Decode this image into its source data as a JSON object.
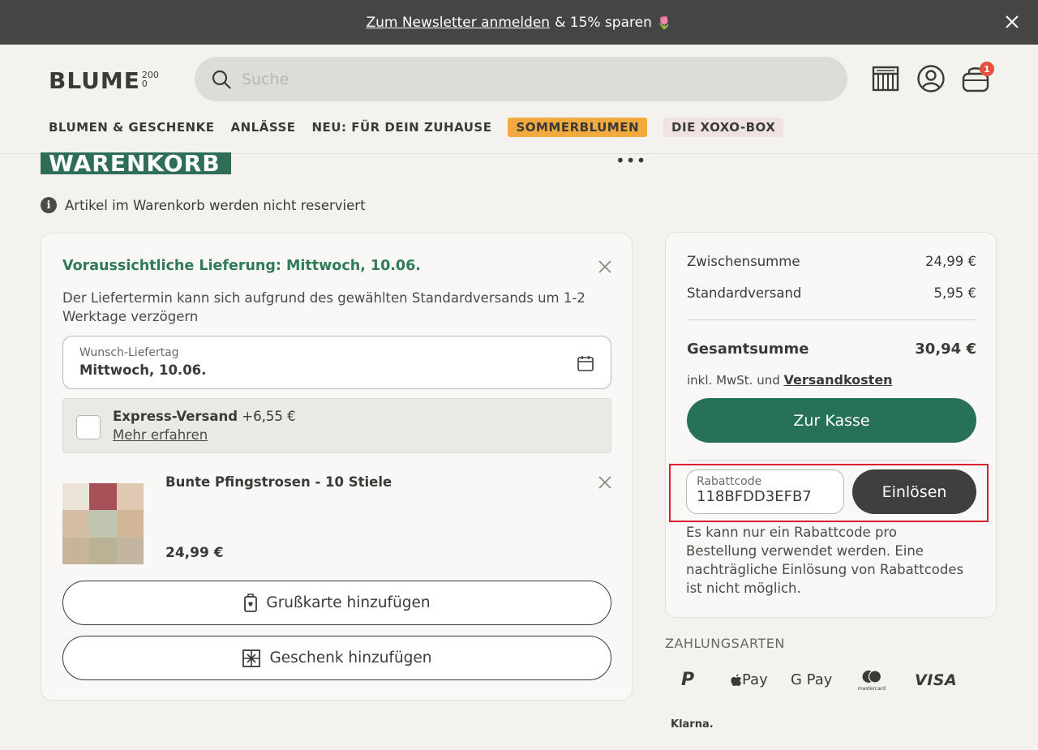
{
  "banner": {
    "link_text": "Zum Newsletter anmelden",
    "rest_text": "& 15% sparen",
    "emoji": "🌷"
  },
  "header": {
    "logo_main": "BLUME",
    "logo_sup": "2000",
    "search_placeholder": "Suche",
    "cart_count": "1"
  },
  "nav": {
    "items": [
      "BLUMEN & GESCHENKE",
      "ANLÄSSE",
      "NEU: FÜR DEIN ZUHAUSE",
      "SOMMERBLUMEN",
      "DIE XOXO-BOX"
    ]
  },
  "page": {
    "title": "WARENKORB",
    "more": "•••",
    "info_text": "Artikel im Warenkorb werden nicht reserviert"
  },
  "delivery": {
    "title": "Voraussichtliche Lieferung: Mittwoch, 10.06.",
    "text": "Der Liefertermin kann sich aufgrund des gewählten Standardversands um 1-2 Werktage verzögern",
    "date_label": "Wunsch-Liefertag",
    "date_value": "Mittwoch, 10.06.",
    "express_title": "Express-Versand",
    "express_price": "+6,55 €",
    "express_link": "Mehr erfahren"
  },
  "product": {
    "name": "Bunte Pfingstrosen - 10 Stiele",
    "price": "24,99 €",
    "swatches": [
      "#ece3d8",
      "#a65158",
      "#dfc9b2",
      "#d3bea5",
      "#bfc5ae",
      "#d1b697",
      "#c7b49a",
      "#bab295",
      "#c4b5a0"
    ]
  },
  "actions": {
    "greeting_card": "Grußkarte hinzufügen",
    "gift": "Geschenk hinzufügen"
  },
  "summary": {
    "subtotal_label": "Zwischensumme",
    "subtotal_value": "24,99 €",
    "shipping_label": "Standardversand",
    "shipping_value": "5,95 €",
    "total_label": "Gesamtsumme",
    "total_value": "30,94 €",
    "incl_text": "inkl. MwSt. und",
    "shipping_costs_link": "Versandkosten",
    "checkout_label": "Zur Kasse"
  },
  "promo": {
    "label": "Rabattcode",
    "value": "118BFDD3EFB7",
    "redeem_label": "Einlösen",
    "note": "Es kann nur ein Rabattcode pro Bestellung verwendet werden. Eine nachträgliche Einlösung von Rabattcodes ist nicht möglich."
  },
  "payment": {
    "title": "ZAHLUNGSARTEN",
    "methods": [
      "P",
      "Pay",
      "G Pay",
      "mastercard",
      "VISA",
      "Klarna."
    ]
  },
  "colors": {
    "accent_green": "#267158",
    "banner_bg": "#454644",
    "highlight_red": "#d9202b",
    "badge_red": "#e4513d",
    "nav_orange": "#f2aa3f"
  }
}
